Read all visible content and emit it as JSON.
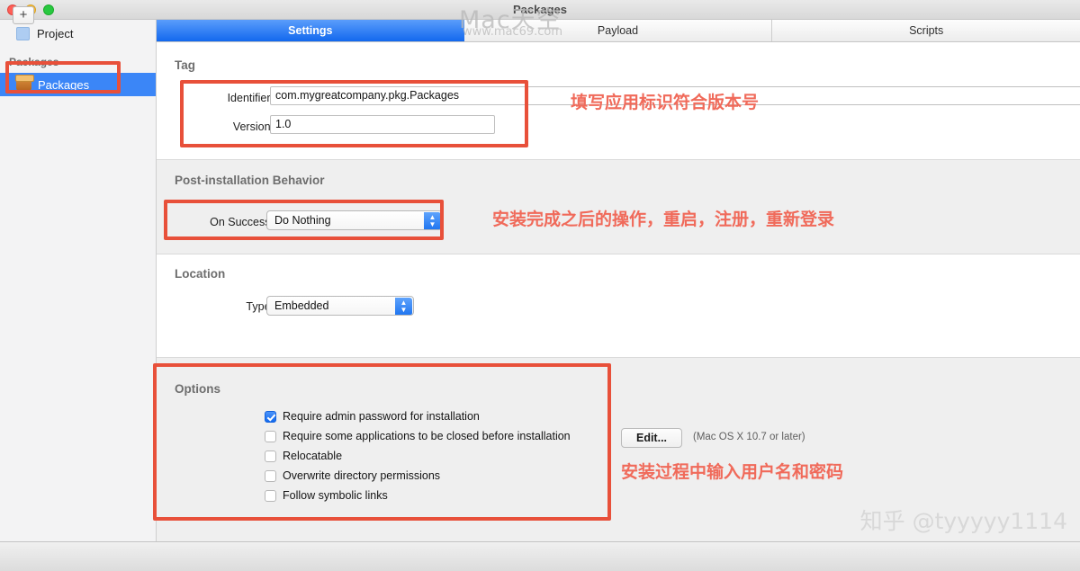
{
  "window": {
    "title": "Packages",
    "traffic_lights": [
      "close-button",
      "minimize-button",
      "zoom-button"
    ]
  },
  "sidebar": {
    "project_item": {
      "label": "Project",
      "icon": "document-icon"
    },
    "group_header": "Packages",
    "packages_item": {
      "label": "Packages",
      "icon": "package-box-icon",
      "selected": true
    },
    "add_button_label": "+"
  },
  "tabs": [
    {
      "label": "Settings",
      "active": true
    },
    {
      "label": "Payload",
      "active": false
    },
    {
      "label": "Scripts",
      "active": false
    }
  ],
  "sections": {
    "tag": {
      "title": "Tag",
      "identifier_label": "Identifier:",
      "identifier_value": "com.mygreatcompany.pkg.Packages",
      "version_label": "Version:",
      "version_value": "1.0"
    },
    "post_install": {
      "title": "Post-installation Behavior",
      "on_success_label": "On Success:",
      "on_success_value": "Do Nothing"
    },
    "location": {
      "title": "Location",
      "type_label": "Type:",
      "type_value": "Embedded"
    },
    "options": {
      "title": "Options",
      "checkboxes": [
        {
          "label": "Require admin password for installation",
          "checked": true
        },
        {
          "label": "Require some applications to be closed before installation",
          "checked": false
        },
        {
          "label": "Relocatable",
          "checked": false
        },
        {
          "label": "Overwrite directory permissions",
          "checked": false
        },
        {
          "label": "Follow symbolic links",
          "checked": false
        }
      ],
      "edit_button_label": "Edit...",
      "edit_hint": "(Mac OS X 10.7 or later)"
    }
  },
  "annotations": {
    "tag_note": "填写应用标识符合版本号",
    "post_install_note": "安装完成之后的操作，重启，注册，重新登录",
    "options_note": "安装过程中输入用户名和密码",
    "highlight_color": "#e8503a",
    "text_color": "#f06a5a"
  },
  "watermarks": {
    "mac_line1": "Mac天空",
    "mac_line2": "www.mac69.com",
    "zhihu": "知乎 @tyyyyy1114"
  }
}
